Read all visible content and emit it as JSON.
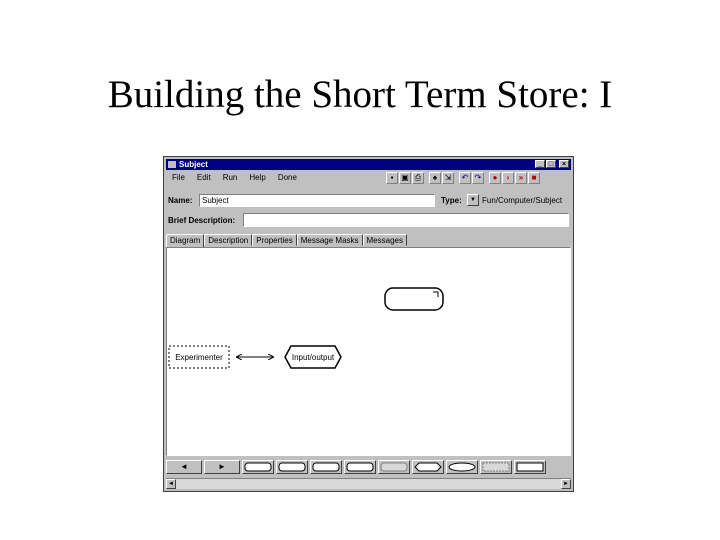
{
  "slide": {
    "title": "Building the Short Term Store: I"
  },
  "window": {
    "title": "Subject",
    "controls": {
      "minimize": "_",
      "maximize": "□",
      "close": "×"
    }
  },
  "menu": {
    "items": [
      "File",
      "Edit",
      "Run",
      "Help",
      "Done"
    ]
  },
  "toolbar": {
    "buttons": [
      {
        "icon": "save-icon",
        "glyph": "▪"
      },
      {
        "icon": "book-icon",
        "glyph": "▣"
      },
      {
        "icon": "print-icon",
        "glyph": "⎙"
      },
      {
        "icon": "find-icon",
        "glyph": "♠"
      },
      {
        "icon": "zoom-icon",
        "glyph": "⇲"
      },
      {
        "icon": "undo-icon",
        "glyph": "↶"
      },
      {
        "icon": "redo-icon",
        "glyph": "↷"
      },
      {
        "icon": "record-icon",
        "glyph": "●"
      },
      {
        "icon": "step-icon",
        "glyph": "›"
      },
      {
        "icon": "fast-forward-icon",
        "glyph": "»"
      },
      {
        "icon": "stop-icon",
        "glyph": "■"
      }
    ]
  },
  "form": {
    "name_label": "Name:",
    "name_value": "Subject",
    "type_label": "Type:",
    "type_value": "Fun/Computer/Subject",
    "description_label": "Brief Description:",
    "description_value": ""
  },
  "tabs": [
    "Diagram",
    "Description",
    "Properties",
    "Message Masks",
    "Messages"
  ],
  "diagram": {
    "nodes": [
      {
        "id": "experimenter",
        "label": "Experimenter",
        "shape": "dashed-rect"
      },
      {
        "id": "input-output",
        "label": "Input/output",
        "shape": "hexagon"
      },
      {
        "id": "empty-store",
        "label": "",
        "shape": "rounded-rect"
      }
    ],
    "edges": [
      {
        "from": "experimenter",
        "to": "input-output",
        "style": "bidirectional"
      }
    ]
  },
  "palette": {
    "nav_left": "◄",
    "nav_right": "►",
    "shapes": [
      "rounded-rect",
      "rounded-rect",
      "rounded-rect",
      "rounded-rect",
      "rounded-rect-grey",
      "hexagon",
      "ellipse",
      "rect-grey",
      "rect"
    ]
  }
}
